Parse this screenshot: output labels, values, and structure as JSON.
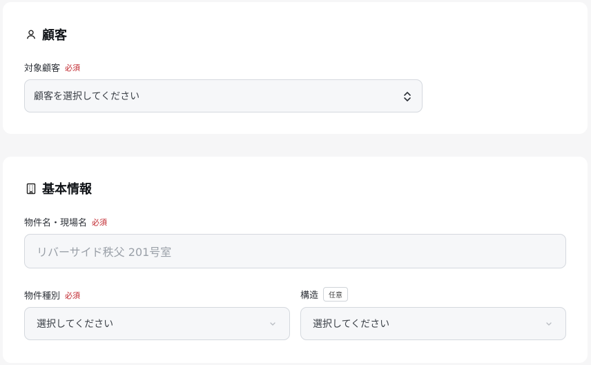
{
  "customer_section": {
    "title": "顧客",
    "target_label": "対象顧客",
    "required_badge": "必須",
    "select_value": "顧客を選択してください"
  },
  "basic_section": {
    "title": "基本情報",
    "name_label": "物件名・現場名",
    "name_required": "必須",
    "name_placeholder": "リバーサイド秩父 201号室",
    "type_label": "物件種別",
    "type_required": "必須",
    "type_value": "選択してください",
    "structure_label": "構造",
    "structure_optional": "任意",
    "structure_value": "選択してください"
  }
}
